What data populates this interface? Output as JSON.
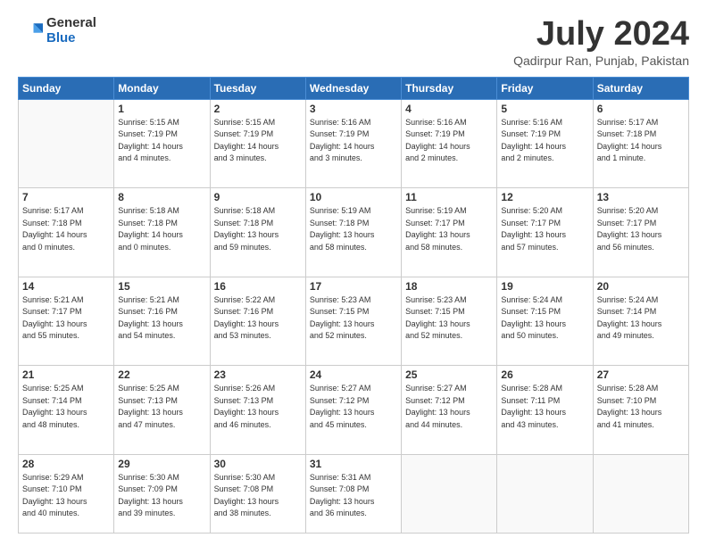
{
  "header": {
    "logo_general": "General",
    "logo_blue": "Blue",
    "title": "July 2024",
    "location": "Qadirpur Ran, Punjab, Pakistan"
  },
  "days_of_week": [
    "Sunday",
    "Monday",
    "Tuesday",
    "Wednesday",
    "Thursday",
    "Friday",
    "Saturday"
  ],
  "weeks": [
    [
      {
        "day": "",
        "info": ""
      },
      {
        "day": "1",
        "info": "Sunrise: 5:15 AM\nSunset: 7:19 PM\nDaylight: 14 hours\nand 4 minutes."
      },
      {
        "day": "2",
        "info": "Sunrise: 5:15 AM\nSunset: 7:19 PM\nDaylight: 14 hours\nand 3 minutes."
      },
      {
        "day": "3",
        "info": "Sunrise: 5:16 AM\nSunset: 7:19 PM\nDaylight: 14 hours\nand 3 minutes."
      },
      {
        "day": "4",
        "info": "Sunrise: 5:16 AM\nSunset: 7:19 PM\nDaylight: 14 hours\nand 2 minutes."
      },
      {
        "day": "5",
        "info": "Sunrise: 5:16 AM\nSunset: 7:19 PM\nDaylight: 14 hours\nand 2 minutes."
      },
      {
        "day": "6",
        "info": "Sunrise: 5:17 AM\nSunset: 7:18 PM\nDaylight: 14 hours\nand 1 minute."
      }
    ],
    [
      {
        "day": "7",
        "info": "Sunrise: 5:17 AM\nSunset: 7:18 PM\nDaylight: 14 hours\nand 0 minutes."
      },
      {
        "day": "8",
        "info": "Sunrise: 5:18 AM\nSunset: 7:18 PM\nDaylight: 14 hours\nand 0 minutes."
      },
      {
        "day": "9",
        "info": "Sunrise: 5:18 AM\nSunset: 7:18 PM\nDaylight: 13 hours\nand 59 minutes."
      },
      {
        "day": "10",
        "info": "Sunrise: 5:19 AM\nSunset: 7:18 PM\nDaylight: 13 hours\nand 58 minutes."
      },
      {
        "day": "11",
        "info": "Sunrise: 5:19 AM\nSunset: 7:17 PM\nDaylight: 13 hours\nand 58 minutes."
      },
      {
        "day": "12",
        "info": "Sunrise: 5:20 AM\nSunset: 7:17 PM\nDaylight: 13 hours\nand 57 minutes."
      },
      {
        "day": "13",
        "info": "Sunrise: 5:20 AM\nSunset: 7:17 PM\nDaylight: 13 hours\nand 56 minutes."
      }
    ],
    [
      {
        "day": "14",
        "info": "Sunrise: 5:21 AM\nSunset: 7:17 PM\nDaylight: 13 hours\nand 55 minutes."
      },
      {
        "day": "15",
        "info": "Sunrise: 5:21 AM\nSunset: 7:16 PM\nDaylight: 13 hours\nand 54 minutes."
      },
      {
        "day": "16",
        "info": "Sunrise: 5:22 AM\nSunset: 7:16 PM\nDaylight: 13 hours\nand 53 minutes."
      },
      {
        "day": "17",
        "info": "Sunrise: 5:23 AM\nSunset: 7:15 PM\nDaylight: 13 hours\nand 52 minutes."
      },
      {
        "day": "18",
        "info": "Sunrise: 5:23 AM\nSunset: 7:15 PM\nDaylight: 13 hours\nand 52 minutes."
      },
      {
        "day": "19",
        "info": "Sunrise: 5:24 AM\nSunset: 7:15 PM\nDaylight: 13 hours\nand 50 minutes."
      },
      {
        "day": "20",
        "info": "Sunrise: 5:24 AM\nSunset: 7:14 PM\nDaylight: 13 hours\nand 49 minutes."
      }
    ],
    [
      {
        "day": "21",
        "info": "Sunrise: 5:25 AM\nSunset: 7:14 PM\nDaylight: 13 hours\nand 48 minutes."
      },
      {
        "day": "22",
        "info": "Sunrise: 5:25 AM\nSunset: 7:13 PM\nDaylight: 13 hours\nand 47 minutes."
      },
      {
        "day": "23",
        "info": "Sunrise: 5:26 AM\nSunset: 7:13 PM\nDaylight: 13 hours\nand 46 minutes."
      },
      {
        "day": "24",
        "info": "Sunrise: 5:27 AM\nSunset: 7:12 PM\nDaylight: 13 hours\nand 45 minutes."
      },
      {
        "day": "25",
        "info": "Sunrise: 5:27 AM\nSunset: 7:12 PM\nDaylight: 13 hours\nand 44 minutes."
      },
      {
        "day": "26",
        "info": "Sunrise: 5:28 AM\nSunset: 7:11 PM\nDaylight: 13 hours\nand 43 minutes."
      },
      {
        "day": "27",
        "info": "Sunrise: 5:28 AM\nSunset: 7:10 PM\nDaylight: 13 hours\nand 41 minutes."
      }
    ],
    [
      {
        "day": "28",
        "info": "Sunrise: 5:29 AM\nSunset: 7:10 PM\nDaylight: 13 hours\nand 40 minutes."
      },
      {
        "day": "29",
        "info": "Sunrise: 5:30 AM\nSunset: 7:09 PM\nDaylight: 13 hours\nand 39 minutes."
      },
      {
        "day": "30",
        "info": "Sunrise: 5:30 AM\nSunset: 7:08 PM\nDaylight: 13 hours\nand 38 minutes."
      },
      {
        "day": "31",
        "info": "Sunrise: 5:31 AM\nSunset: 7:08 PM\nDaylight: 13 hours\nand 36 minutes."
      },
      {
        "day": "",
        "info": ""
      },
      {
        "day": "",
        "info": ""
      },
      {
        "day": "",
        "info": ""
      }
    ]
  ]
}
